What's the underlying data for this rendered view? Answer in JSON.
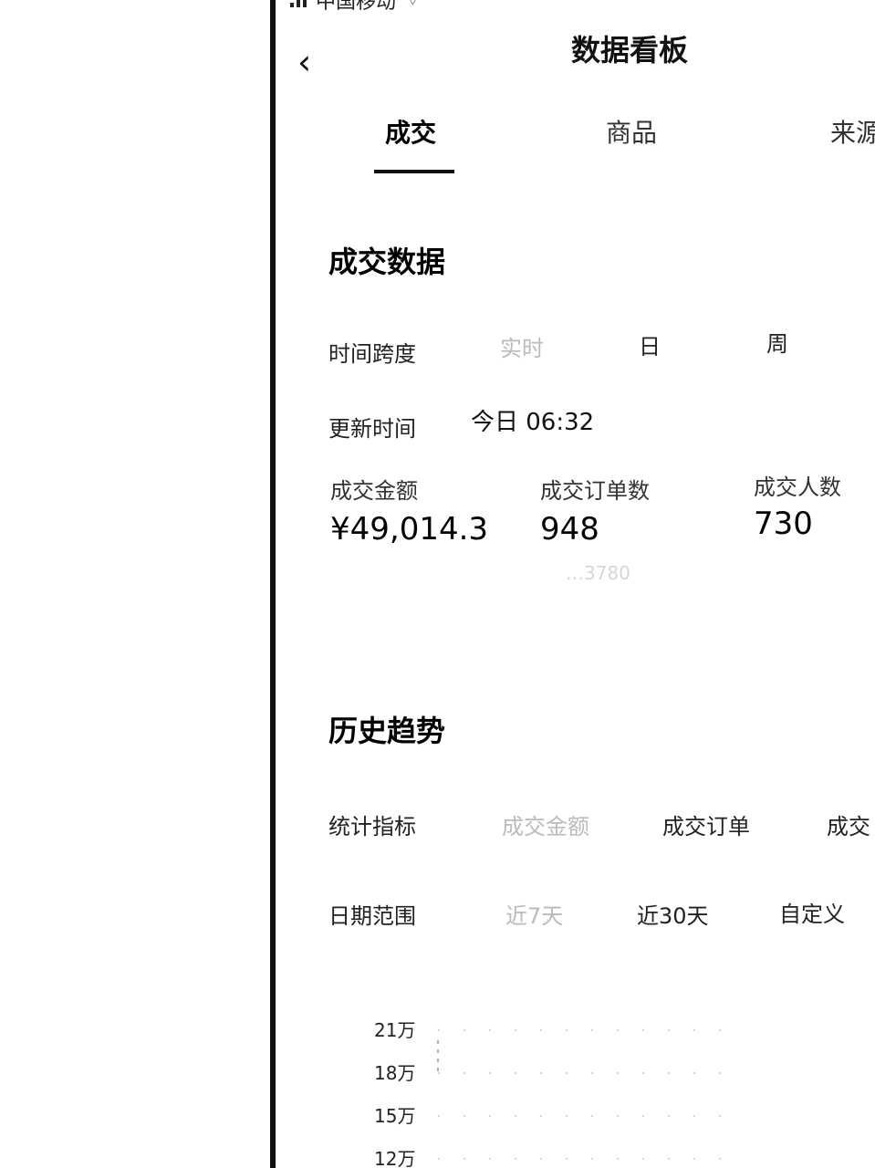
{
  "status_bar": {
    "carrier": "中国移动",
    "time": ""
  },
  "nav": {
    "back_glyph": "‹",
    "title": "数据看板"
  },
  "tabs": [
    {
      "label": "成交",
      "active": true
    },
    {
      "label": "商品",
      "active": false
    },
    {
      "label": "来源",
      "active": false
    }
  ],
  "deal_section": {
    "title": "成交数据",
    "time_span": {
      "label": "时间跨度",
      "options": [
        "实时",
        "日",
        "周"
      ]
    },
    "update": {
      "label": "更新时间",
      "value": "今日 06:32"
    },
    "metrics": [
      {
        "label": "成交金额",
        "value": "¥49,014.3",
        "sub": ""
      },
      {
        "label": "成交订单数",
        "value": "948",
        "sub": "…3780"
      },
      {
        "label": "成交人数",
        "value": "730",
        "sub": ""
      }
    ]
  },
  "history_section": {
    "title": "历史趋势",
    "metric_filter": {
      "label": "统计指标",
      "options": [
        "成交金额",
        "成交订单",
        "成交"
      ]
    },
    "date_range": {
      "label": "日期范围",
      "options": [
        "近7天",
        "近30天",
        "自定义"
      ]
    }
  },
  "chart_data": {
    "type": "line",
    "y_ticks": [
      "21万",
      "18万",
      "15万",
      "12万"
    ],
    "grid": true
  },
  "colors": {
    "text": "#111111",
    "faint": "#bbbbbb",
    "background": "#ffffff",
    "edge": "#111111"
  }
}
